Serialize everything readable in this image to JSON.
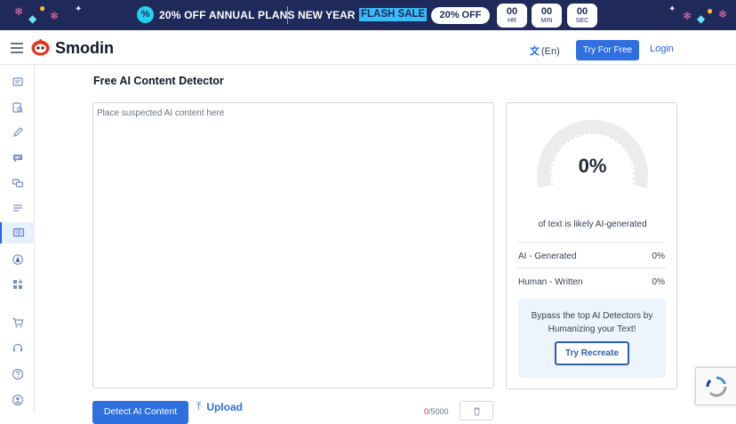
{
  "banner": {
    "offer": "20% OFF ANNUAL PLANS",
    "new_year": "NEW YEAR",
    "flash_sale": "FLASH SALE",
    "discount_pill": "20% OFF",
    "timer": [
      {
        "value": "00",
        "unit": "HR"
      },
      {
        "value": "00",
        "unit": "MIN"
      },
      {
        "value": "00",
        "unit": "SEC"
      }
    ]
  },
  "header": {
    "brand": "Smodin",
    "language": "(En)",
    "try_free": "Try For Free",
    "login": "Login"
  },
  "sidebar": {
    "items": [
      {
        "icon": "rewriter-icon"
      },
      {
        "icon": "plagiarism-icon"
      },
      {
        "icon": "pencil-icon"
      },
      {
        "icon": "chat-icon"
      },
      {
        "icon": "translate-icon"
      },
      {
        "icon": "summarizer-icon"
      },
      {
        "icon": "ai-detector-icon",
        "active": true
      },
      {
        "icon": "grader-icon"
      },
      {
        "icon": "apps-icon"
      },
      {
        "icon": "cart-icon"
      },
      {
        "icon": "support-icon"
      },
      {
        "icon": "help-icon"
      },
      {
        "icon": "account-icon"
      }
    ]
  },
  "main": {
    "title": "Free AI Content Detector",
    "editor_placeholder": "Place suspected AI content here",
    "detect_button": "Detect AI Content",
    "upload": "Upload",
    "char_used": "0",
    "char_limit": "/5000"
  },
  "result": {
    "percent": "0%",
    "likely_text": "of text is likely AI-generated",
    "rows": [
      {
        "label": "AI - Generated",
        "value": "0%"
      },
      {
        "label": "Human - Written",
        "value": "0%"
      }
    ],
    "promo_text": "Bypass the top AI Detectors by Humanizing your Text!",
    "recreate_button": "Try Recreate"
  },
  "colors": {
    "banner_bg": "#1f2a5a",
    "accent": "#2f6fe0",
    "flash_highlight": "#38bdf8",
    "counter_used": "#dc2626"
  }
}
